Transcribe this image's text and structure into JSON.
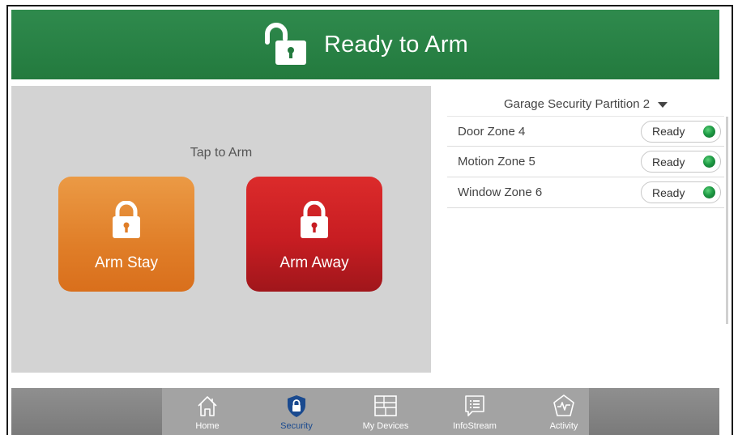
{
  "header": {
    "title": "Ready to Arm",
    "icon": "unlocked-padlock-icon",
    "background_color": "#2a8447"
  },
  "arm_panel": {
    "tap_label": "Tap to Arm",
    "buttons": [
      {
        "label": "Arm Stay",
        "icon": "padlock-icon",
        "color": "#e5862f"
      },
      {
        "label": "Arm Away",
        "icon": "padlock-icon",
        "color": "#c71d22"
      }
    ]
  },
  "zones": {
    "partition_label": "Garage Security Partition 2",
    "items": [
      {
        "name": "Door Zone 4",
        "status": "Ready",
        "status_color": "#1e9a44"
      },
      {
        "name": "Motion Zone 5",
        "status": "Ready",
        "status_color": "#1e9a44"
      },
      {
        "name": "Window Zone 6",
        "status": "Ready",
        "status_color": "#1e9a44"
      }
    ]
  },
  "nav": {
    "active": "Security",
    "active_color": "#1a4a8f",
    "items": [
      {
        "label": "Home",
        "icon": "home-icon"
      },
      {
        "label": "Security",
        "icon": "shield-lock-icon"
      },
      {
        "label": "My Devices",
        "icon": "devices-grid-icon"
      },
      {
        "label": "InfoStream",
        "icon": "message-list-icon"
      },
      {
        "label": "Activity",
        "icon": "activity-pulse-icon"
      }
    ]
  }
}
